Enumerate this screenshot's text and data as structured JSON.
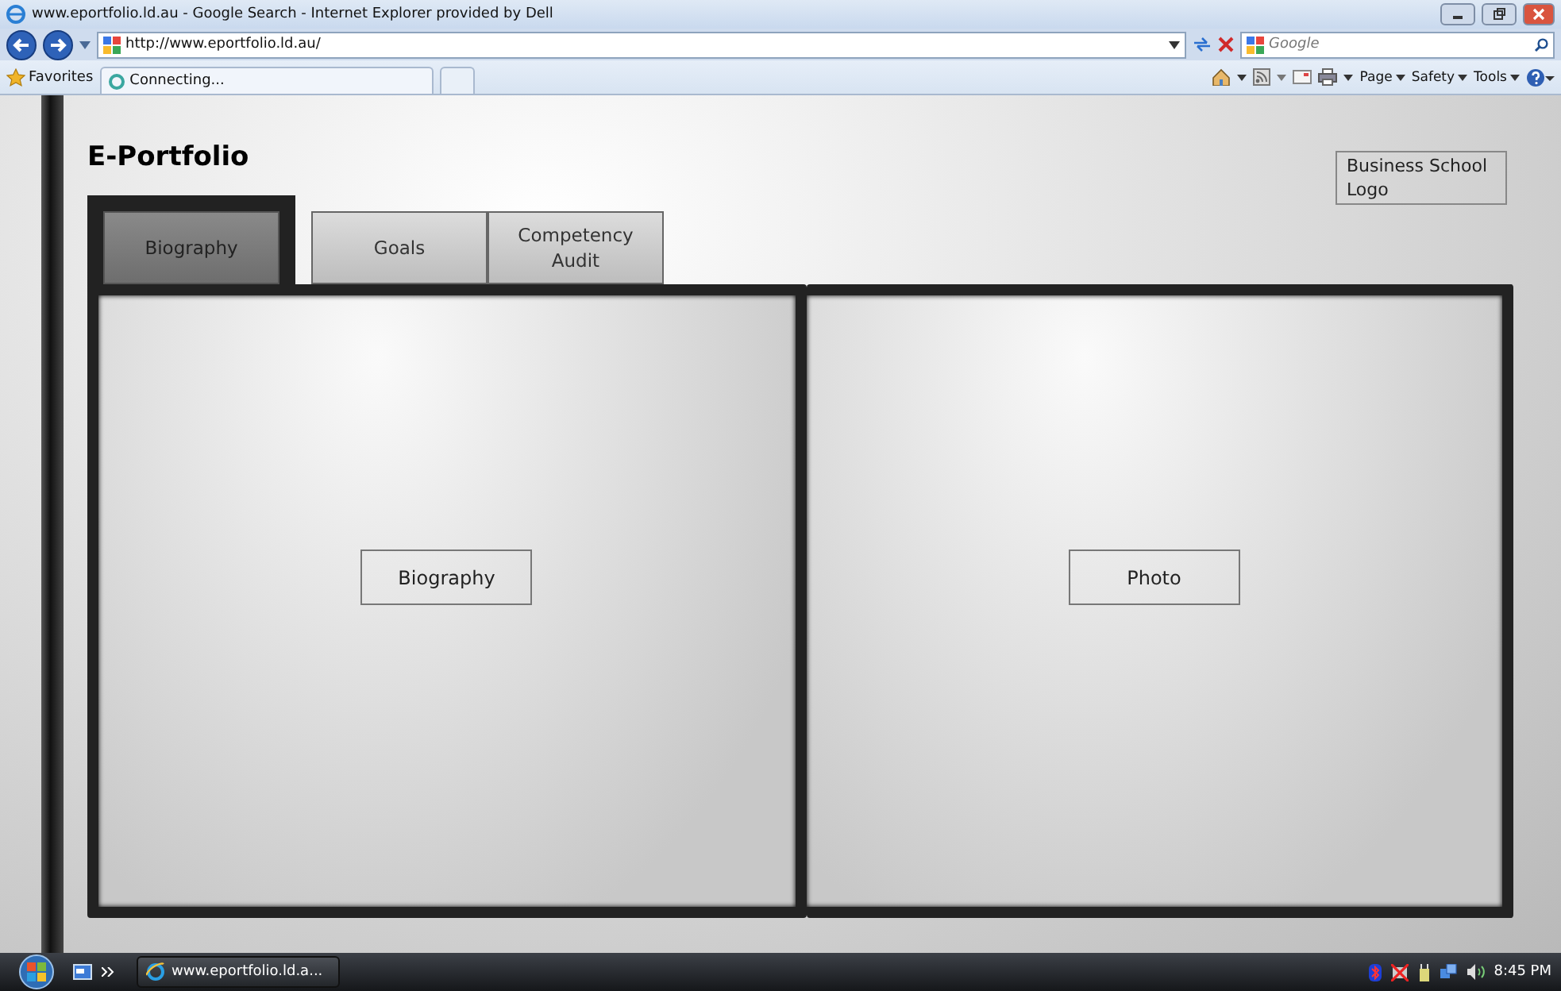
{
  "browser": {
    "title": "www.eportfolio.ld.au - Google Search - Internet Explorer provided by Dell",
    "address": "http://www.eportfolio.ld.au/",
    "search_placeholder": "Google",
    "favorites": "Favorites",
    "tab": "Connecting...",
    "commands": [
      "Page",
      "Safety",
      "Tools"
    ]
  },
  "page": {
    "title": "E-Portfolio",
    "logo": "Business School Logo",
    "tabs": [
      {
        "label": "Biography",
        "selected": true
      },
      {
        "label": "Goals",
        "selected": false
      },
      {
        "label": "Competency Audit",
        "selected": false
      }
    ],
    "panels": [
      {
        "label": "Biography"
      },
      {
        "label": "Photo"
      }
    ]
  },
  "taskbar": {
    "task": "www.eportfolio.ld.a...",
    "clock": "8:45 PM"
  }
}
